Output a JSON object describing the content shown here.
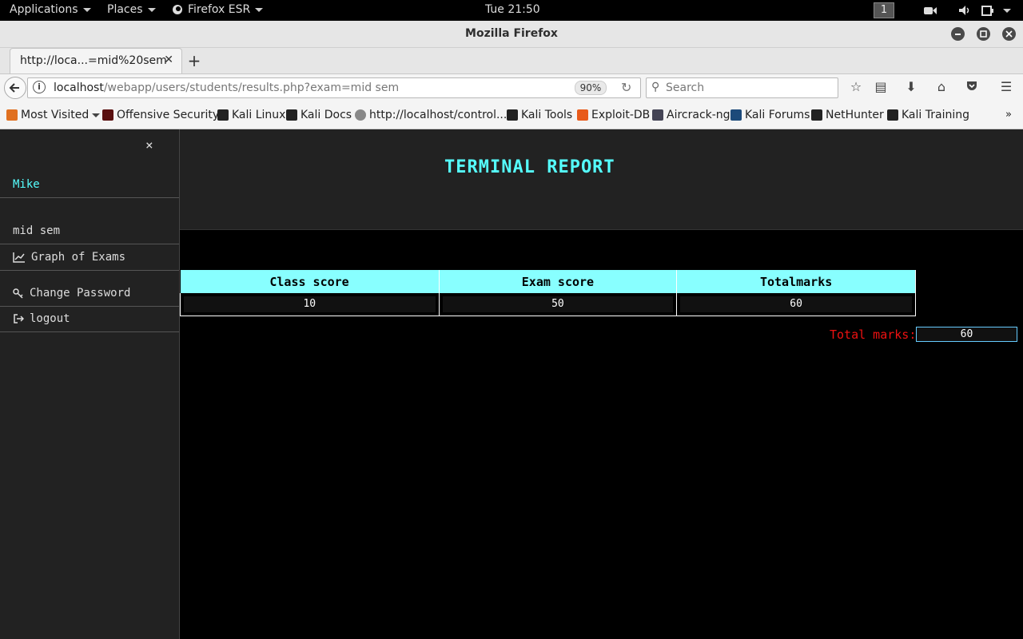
{
  "system_bar": {
    "applications": "Applications",
    "places": "Places",
    "firefox_menu": "Firefox ESR",
    "clock": "Tue 21:50",
    "workspace": "1"
  },
  "window": {
    "title": "Mozilla Firefox"
  },
  "tabs": [
    {
      "label": "http://loca...=mid%20sem"
    }
  ],
  "navbar": {
    "url_host": "localhost",
    "url_path": "/webapp/users/students/results.php?exam=mid sem",
    "zoom": "90%",
    "search_placeholder": "Search"
  },
  "bookmarks": [
    {
      "label": "Most Visited",
      "icon": "most-visited-icon"
    },
    {
      "label": "Offensive Security",
      "icon": "offsec-icon"
    },
    {
      "label": "Kali Linux",
      "icon": "kali-icon"
    },
    {
      "label": "Kali Docs",
      "icon": "kali-icon"
    },
    {
      "label": "http://localhost/control...",
      "icon": "globe-icon"
    },
    {
      "label": "Kali Tools",
      "icon": "kali-icon"
    },
    {
      "label": "Exploit-DB",
      "icon": "exploit-db-icon"
    },
    {
      "label": "Aircrack-ng",
      "icon": "aircrack-icon"
    },
    {
      "label": "Kali Forums",
      "icon": "kali-forums-icon"
    },
    {
      "label": "NetHunter",
      "icon": "kali-icon"
    },
    {
      "label": "Kali Training",
      "icon": "kali-icon"
    }
  ],
  "sidebar": {
    "close": "×",
    "user": "Mike",
    "exam": "mid sem",
    "graph": "Graph of Exams",
    "change_password": "Change Password",
    "logout": "logout"
  },
  "report": {
    "title": "TERMINAL REPORT",
    "columns": [
      "Class score",
      "Exam score",
      "Totalmarks"
    ],
    "row": [
      "10",
      "50",
      "60"
    ],
    "total_label": "Total marks:",
    "total_value": "60"
  },
  "colors": {
    "accent_cyan": "#55ffff",
    "table_header": "#88ffff",
    "total_label": "#ee1111"
  }
}
